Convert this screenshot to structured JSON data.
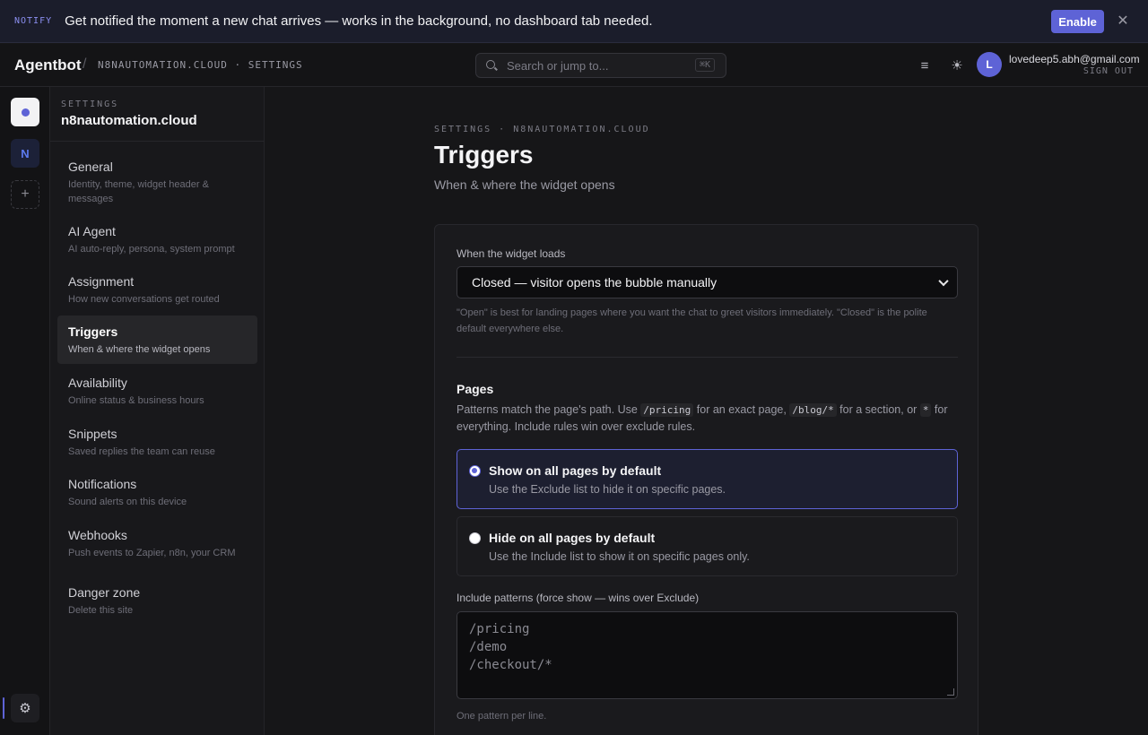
{
  "notify": {
    "tag": "NOTIFY",
    "message": "Get notified the moment a new chat arrives — works in the background, no dashboard tab needed.",
    "enable_label": "Enable",
    "close_glyph": "✕"
  },
  "header": {
    "brand": "Agentbot",
    "separator": "/",
    "crumb": "N8NAUTOMATION.CLOUD · SETTINGS",
    "search_placeholder": "Search or jump to...",
    "search_shortcut": "⌘K",
    "menu_glyph": "≡",
    "theme_glyph": "☀",
    "avatar_initial": "L",
    "user_email": "lovedeep5.abh@gmail.com",
    "sign_out": "SIGN OUT"
  },
  "rail": {
    "site_initial": "N",
    "add_glyph": "+",
    "gear_glyph": "⚙"
  },
  "sidebar": {
    "eyebrow": "SETTINGS",
    "title": "n8nautomation.cloud",
    "items": [
      {
        "label": "General",
        "sub": "Identity, theme, widget header & messages"
      },
      {
        "label": "AI Agent",
        "sub": "AI auto-reply, persona, system prompt"
      },
      {
        "label": "Assignment",
        "sub": "How new conversations get routed"
      },
      {
        "label": "Triggers",
        "sub": "When & where the widget opens"
      },
      {
        "label": "Availability",
        "sub": "Online status & business hours"
      },
      {
        "label": "Snippets",
        "sub": "Saved replies the team can reuse"
      },
      {
        "label": "Notifications",
        "sub": "Sound alerts on this device"
      },
      {
        "label": "Webhooks",
        "sub": "Push events to Zapier, n8n, your CRM"
      },
      {
        "label": "Danger zone",
        "sub": "Delete this site"
      }
    ]
  },
  "main": {
    "eyebrow": "SETTINGS · N8NAUTOMATION.CLOUD",
    "title": "Triggers",
    "subtitle": "When & where the widget opens",
    "load": {
      "label": "When the widget loads",
      "selected": "Closed — visitor opens the bubble manually",
      "hint": "\"Open\" is best for landing pages where you want the chat to greet visitors immediately. \"Closed\" is the polite default everywhere else."
    },
    "pages": {
      "title": "Pages",
      "desc_1": "Patterns match the page's path. Use",
      "code_1": "/pricing",
      "desc_2": "for an exact page,",
      "code_2": "/blog/*",
      "desc_3": "for a section, or",
      "code_3": "*",
      "desc_4": "for everything. Include rules win over exclude rules.",
      "options": [
        {
          "title": "Show on all pages by default",
          "sub": "Use the Exclude list to hide it on specific pages."
        },
        {
          "title": "Hide on all pages by default",
          "sub": "Use the Include list to show it on specific pages only."
        }
      ]
    },
    "include": {
      "label": "Include patterns (force show — wins over Exclude)",
      "lines": [
        "/pricing",
        "/demo",
        "/checkout/*"
      ],
      "hint": "One pattern per line."
    }
  }
}
